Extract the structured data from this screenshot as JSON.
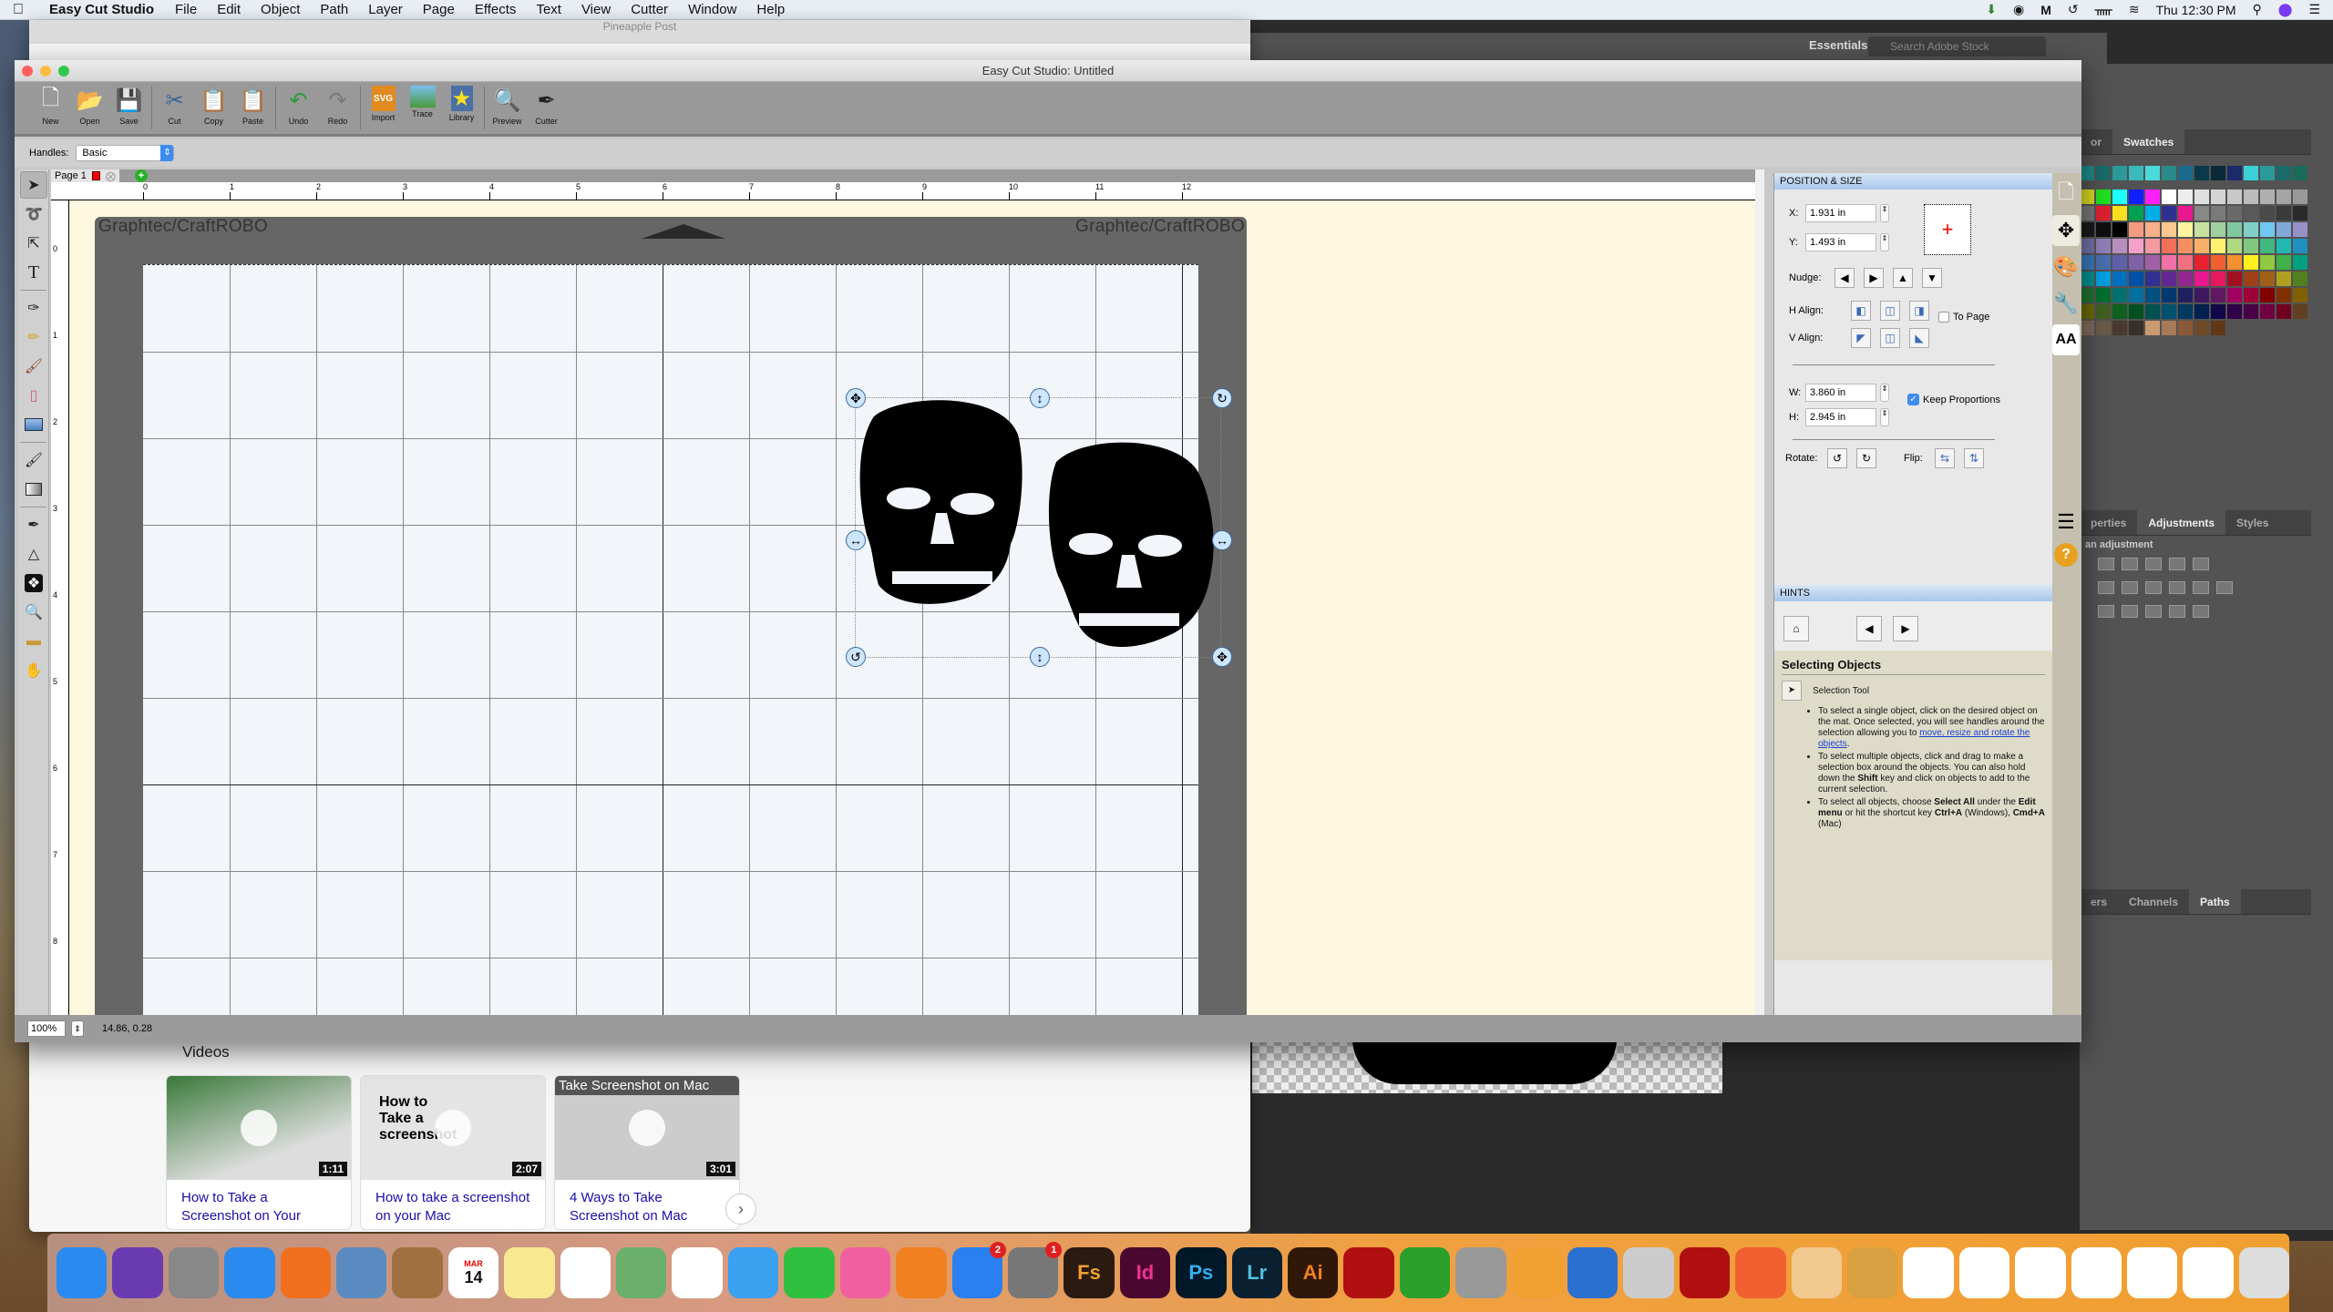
{
  "menubar": {
    "app_name": "Easy Cut Studio",
    "items": [
      "File",
      "Edit",
      "Object",
      "Path",
      "Layer",
      "Page",
      "Effects",
      "Text",
      "View",
      "Cutter",
      "Window",
      "Help"
    ],
    "clock": "Thu 12:30 PM"
  },
  "background": {
    "browser_title": "Pineapple Post",
    "ps_workspace": "Essentials",
    "ps_search_placeholder": "Search Adobe Stock",
    "ps_tabs_top": [
      "or",
      "Swatches"
    ],
    "ps_tabs_mid": [
      "perties",
      "Adjustments",
      "Styles"
    ],
    "ps_adj_label": "an adjustment",
    "ps_tabs_bottom": [
      "ers",
      "Channels",
      "Paths"
    ],
    "videos_heading": "Videos",
    "videos": [
      {
        "duration": "1:11",
        "title": "How to Take a Screenshot on Your"
      },
      {
        "duration": "2:07",
        "title": "How to take a screenshot on your Mac",
        "thumb_text": "How to Take a screenshot"
      },
      {
        "duration": "3:01",
        "title": "4 Ways to Take Screenshot on Mac",
        "thumb_text": "Take Screenshot on Mac"
      }
    ]
  },
  "window": {
    "title": "Easy Cut Studio: Untitled"
  },
  "toolbar": [
    {
      "label": "New",
      "icon": "new-document-icon"
    },
    {
      "label": "Open",
      "icon": "open-folder-icon"
    },
    {
      "label": "Save",
      "icon": "save-disk-icon"
    },
    {
      "label": "Cut",
      "icon": "cut-icon"
    },
    {
      "label": "Copy",
      "icon": "copy-icon"
    },
    {
      "label": "Paste",
      "icon": "paste-icon"
    },
    {
      "label": "Undo",
      "icon": "undo-icon"
    },
    {
      "label": "Redo",
      "icon": "redo-icon"
    },
    {
      "label": "Import",
      "icon": "import-svg-icon"
    },
    {
      "label": "Trace",
      "icon": "trace-icon"
    },
    {
      "label": "Library",
      "icon": "library-icon"
    },
    {
      "label": "Preview",
      "icon": "preview-icon"
    },
    {
      "label": "Cutter",
      "icon": "cutter-icon"
    }
  ],
  "options": {
    "handles_label": "Handles:",
    "handles_value": "Basic"
  },
  "page_tab": {
    "label": "Page 1"
  },
  "mat": {
    "label_left": "Graphtec/CraftROBO",
    "label_right": "Graphtec/CraftROBO"
  },
  "ruler": {
    "h_ticks": [
      "0",
      "1",
      "2",
      "3",
      "4",
      "5",
      "6",
      "7",
      "8",
      "9",
      "10",
      "11",
      "12"
    ],
    "v_ticks": [
      "0",
      "1",
      "2",
      "3",
      "4",
      "5",
      "6",
      "7",
      "8"
    ]
  },
  "position_size": {
    "title": "POSITION & SIZE",
    "x_label": "X:",
    "x_value": "1.931 in",
    "y_label": "Y:",
    "y_value": "1.493 in",
    "nudge_label": "Nudge:",
    "halign_label": "H Align:",
    "valign_label": "V Align:",
    "to_page_label": "To Page",
    "to_page_checked": false,
    "w_label": "W:",
    "w_value": "3.860 in",
    "h_label": "H:",
    "h_value": "2.945 in",
    "keep_proportions_label": "Keep Proportions",
    "keep_proportions_checked": true,
    "rotate_label": "Rotate:",
    "flip_label": "Flip:"
  },
  "hints": {
    "title": "HINTS",
    "heading": "Selecting Objects",
    "tool_name": "Selection Tool",
    "bullet1_pre": "To select a single object, click on the desired object on the mat. Once selected, you will see handles around the selection allowing you to ",
    "bullet1_link": "move, resize and rotate the objects",
    "bullet1_post": ".",
    "bullet2_a": "To select multiple objects, click and drag to make a selection box around the objects. You can also hold down the ",
    "bullet2_b": "Shift",
    "bullet2_c": " key and click on objects to add to the current selection.",
    "bullet3_a": "To select all objects, choose ",
    "bullet3_b": "Select All",
    "bullet3_c": " under the ",
    "bullet3_d": "Edit menu",
    "bullet3_e": " or hit the shortcut key ",
    "bullet3_f": "Ctrl+A",
    "bullet3_g": " (Windows), ",
    "bullet3_h": "Cmd+A",
    "bullet3_i": " (Mac)"
  },
  "status": {
    "zoom": "100%",
    "coords": "14.86, 0.28"
  },
  "dock": {
    "badges": {
      "app_store": "2",
      "system_prefs": "1"
    },
    "apps": [
      "Finder",
      "Siri",
      "Launchpad",
      "Safari",
      "Firefox",
      "Preview",
      "Contacts",
      "Calendar",
      "Notes",
      "Reminders",
      "Maps",
      "Photos",
      "Messages",
      "FaceTime",
      "iTunes",
      "iBooks",
      "App Store",
      "System Preferences",
      "Fs",
      "Id",
      "Ps",
      "Lr",
      "Ai",
      "Acrobat",
      "QuickBooks",
      "Font",
      "Pages",
      "Migration",
      "Music",
      "Photo Booth",
      "Stamp",
      "Help",
      "Archive",
      "Docs",
      "Docs",
      "Docs",
      "Docs",
      "Docs",
      "Docs",
      "Trash"
    ],
    "calendar_month": "MAR",
    "calendar_day": "14"
  }
}
